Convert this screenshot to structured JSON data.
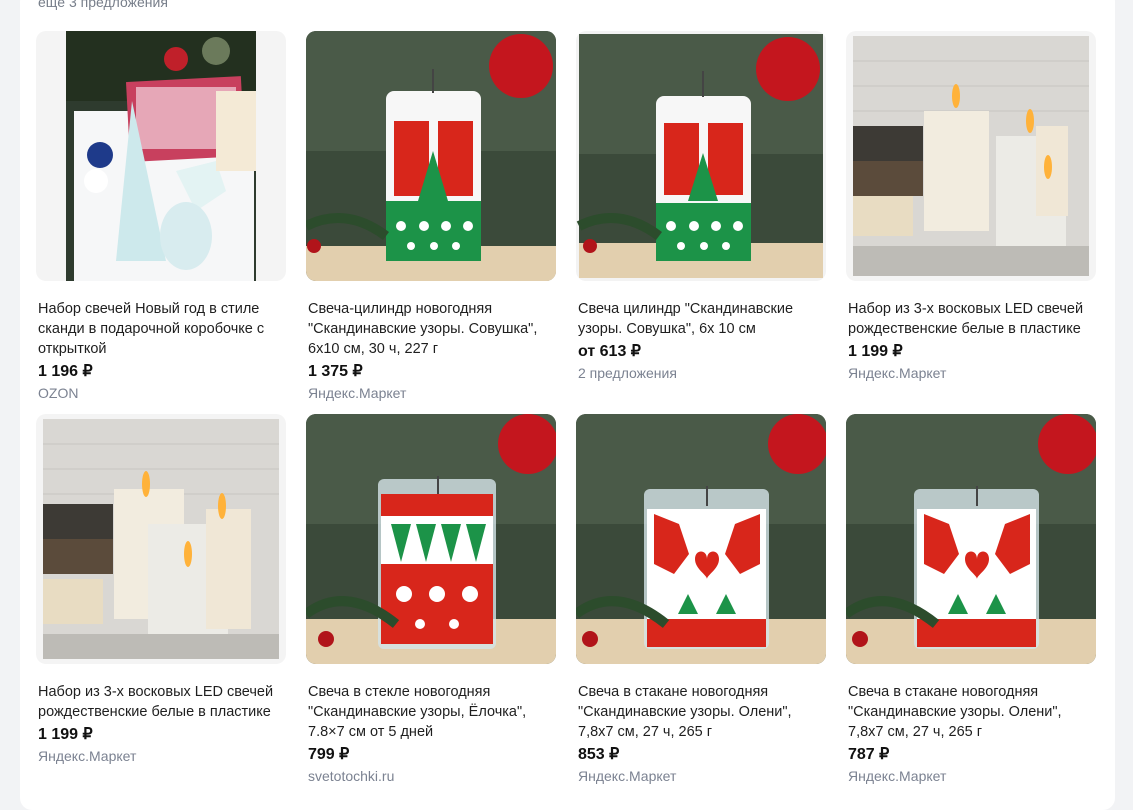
{
  "header": {
    "offers_link": "ещё 3 предложения"
  },
  "products": [
    {
      "title": "Набор свечей Новый год в стиле сканди в подарочной коробочке с открыткой",
      "price": "1 196 ₽",
      "source": "OZON",
      "image": "gift-box-photo"
    },
    {
      "title": "Свеча-цилиндр новогодняя \"Скандинавские узоры. Совушка\", 6х10 см, 30 ч, 227 г",
      "price": "1 375 ₽",
      "source": "Яндекс.Маркет",
      "image": "owl-candle-photo"
    },
    {
      "title": "Свеча цилиндр \"Скандинавские узоры. Совушка\", 6х 10 см",
      "price": "от 613 ₽",
      "source": "2 предложения",
      "image": "owl-candle-photo"
    },
    {
      "title": "Набор из 3-х восковых LED свечей рождественские белые в пластике",
      "price": "1 199 ₽",
      "source": "Яндекс.Маркет",
      "image": "led-candles-photo"
    },
    {
      "title": "Набор из 3-х восковых LED свечей рождественские белые в пластике",
      "price": "1 199 ₽",
      "source": "Яндекс.Маркет",
      "image": "led-candles-photo"
    },
    {
      "title": "Свеча в стекле новогодняя \"Скандинавские узоры, Ёлочка\", 7.8×7 см от 5 дней",
      "price": "799 ₽",
      "source": "svetotochki.ru",
      "image": "glass-tree-candle-photo"
    },
    {
      "title": "Свеча в стакане новогодняя \"Скандинавские узоры. Олени\", 7,8х7 см, 27 ч, 265 г",
      "price": "853 ₽",
      "source": "Яндекс.Маркет",
      "image": "glass-deer-candle-photo"
    },
    {
      "title": "Свеча в стакане новогодняя \"Скандинавские узоры. Олени\", 7,8х7 см, 27 ч, 265 г",
      "price": "787 ₽",
      "source": "Яндекс.Маркет",
      "image": "glass-deer-candle-photo"
    }
  ]
}
